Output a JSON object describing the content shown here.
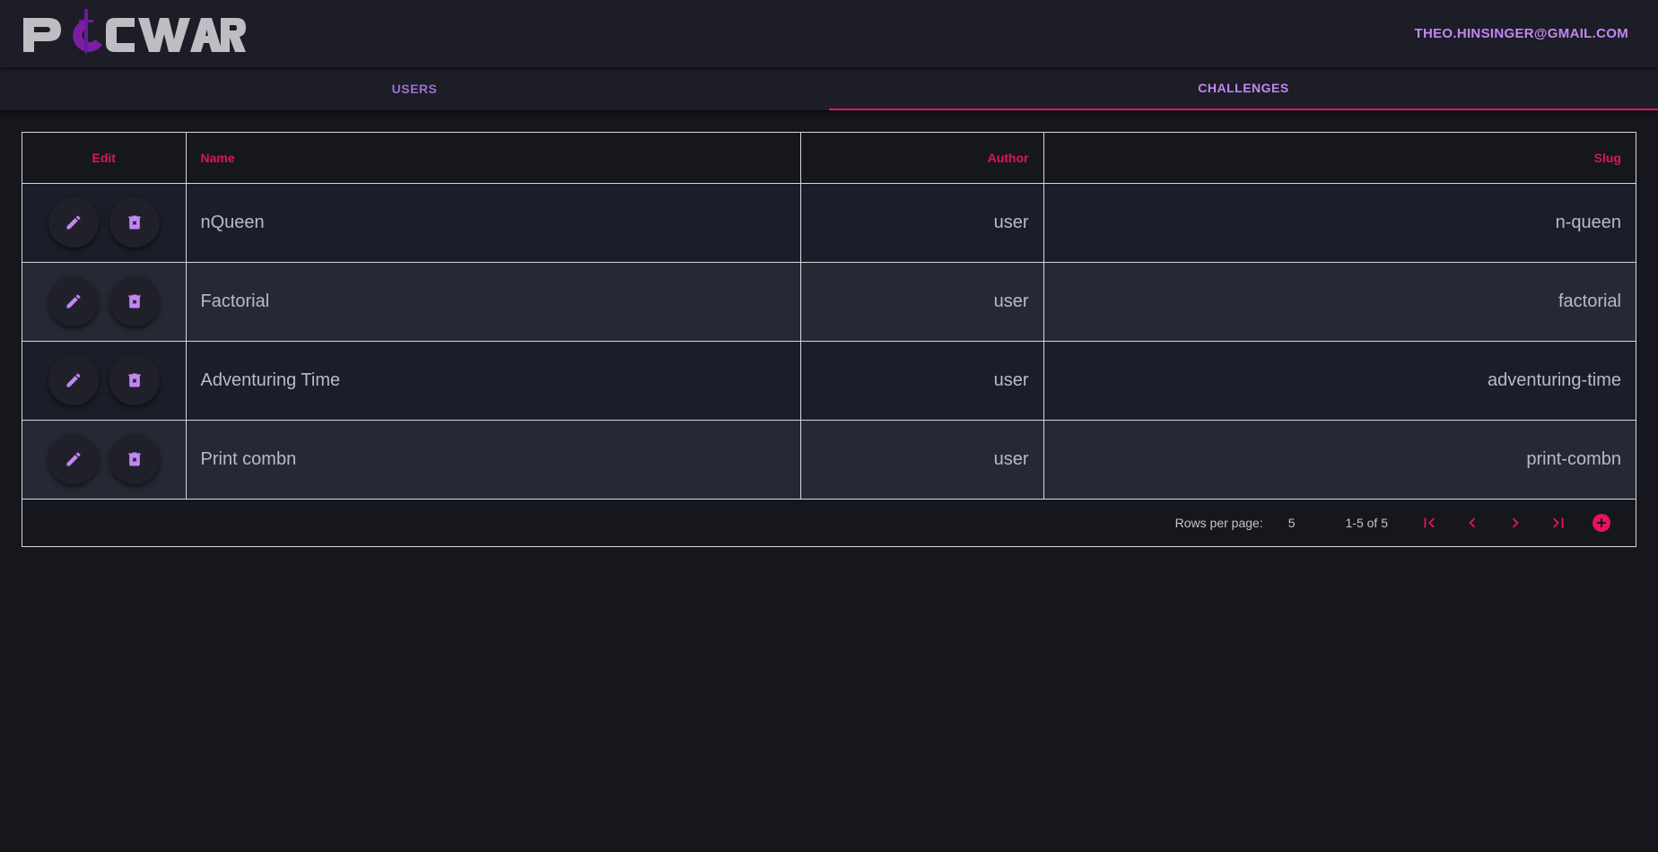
{
  "header": {
    "logo_text": "POCWAR",
    "user_email": "THEO.HINSINGER@GMAIL.COM"
  },
  "tabs": [
    {
      "label": "USERS",
      "active": false
    },
    {
      "label": "CHALLENGES",
      "active": true
    }
  ],
  "table": {
    "columns": [
      "Edit",
      "Name",
      "Author",
      "Slug"
    ],
    "rows": [
      {
        "name": "nQueen",
        "author": "user",
        "slug": "n-queen"
      },
      {
        "name": "Factorial",
        "author": "user",
        "slug": "factorial"
      },
      {
        "name": "Adventuring Time",
        "author": "user",
        "slug": "adventuring-time"
      },
      {
        "name": "Print combn",
        "author": "user",
        "slug": "print-combn"
      }
    ]
  },
  "pagination": {
    "rows_per_page_label": "Rows per page:",
    "rows_per_page_value": "5",
    "range": "1-5 of 5"
  },
  "icons": {
    "edit": "pencil-icon",
    "delete": "trash-icon",
    "first": "first-page-icon",
    "prev": "chevron-left-icon",
    "next": "chevron-right-icon",
    "last": "last-page-icon",
    "add": "add-circle-icon"
  },
  "colors": {
    "accent_pink": "#e6135f",
    "accent_purple": "#c386f3",
    "background": "#16171d"
  }
}
